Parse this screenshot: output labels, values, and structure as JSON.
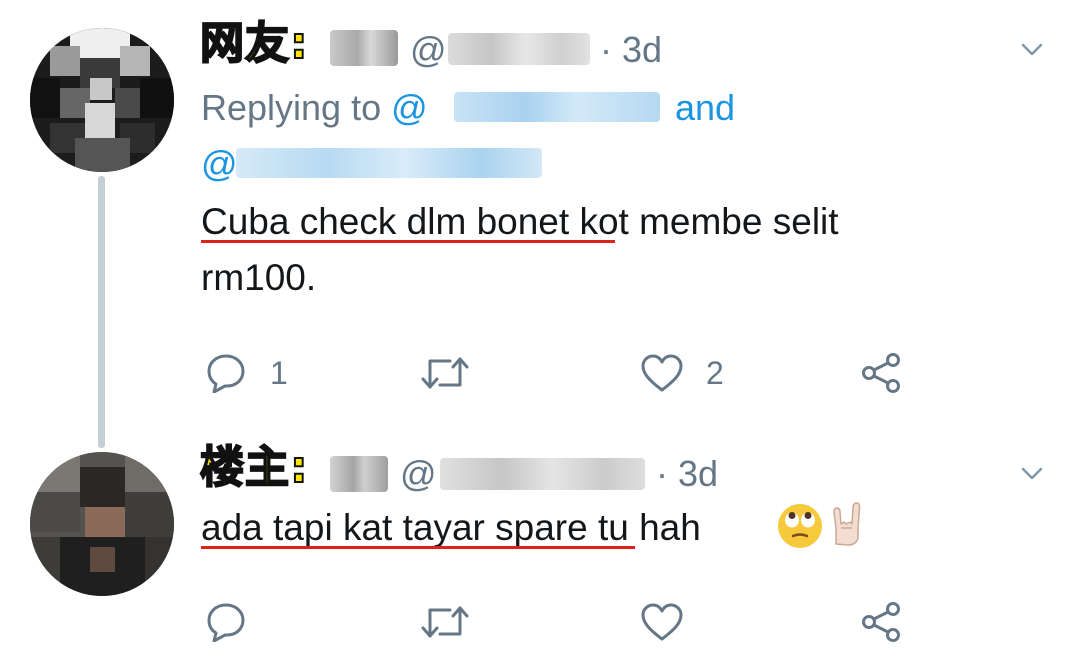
{
  "tweets": [
    {
      "label": "网友:",
      "handle_prefix": "@",
      "time": "· 3d",
      "replying_prefix": "Replying to",
      "replying_at": "@",
      "replying_and": "and",
      "replying_at2": "@",
      "text_underlined": "Cuba check dlm bonet",
      "text_rest": " kot membe selit",
      "text_line2": "rm100.",
      "reply_count": "1",
      "like_count": "2"
    },
    {
      "label": "楼主:",
      "handle_prefix": "@",
      "time": "· 3d",
      "text_underlined": "ada tapi kat tayar spare",
      "text_rest": " tu hah",
      "emoji": [
        "eyes-rolling-face",
        "rock-on-hand"
      ]
    }
  ],
  "icons": [
    "reply-icon",
    "retweet-icon",
    "like-icon",
    "share-icon",
    "chevron-down-icon"
  ],
  "colors": {
    "link": "#1b95e0",
    "muted": "#657786",
    "underline": "#e0201b",
    "label": "#ffe600",
    "thread": "#c4cfd6"
  }
}
